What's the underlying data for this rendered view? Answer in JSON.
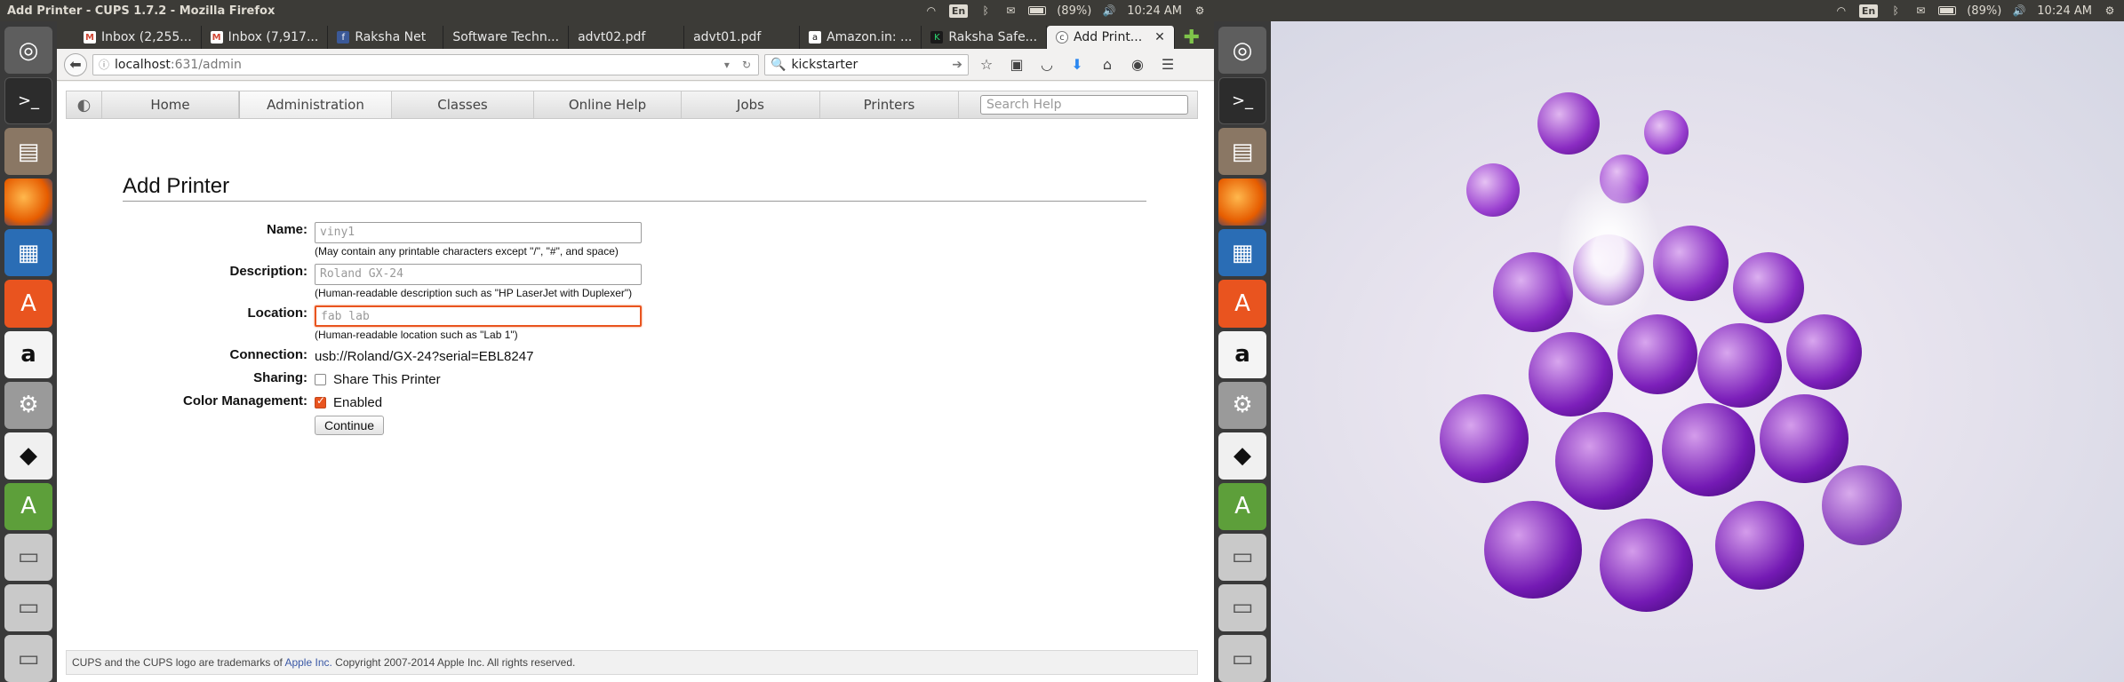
{
  "left": {
    "window_title": "Add Printer - CUPS 1.7.2 - Mozilla Firefox",
    "indicators": {
      "keyboard": "En",
      "battery": "(89%)",
      "time": "10:24 AM"
    },
    "launcher_icons": [
      "ubuntu-dash-icon",
      "terminal-icon",
      "files-icon",
      "firefox-icon",
      "writer-icon",
      "software-center-icon",
      "amazon-icon",
      "settings-icon",
      "inkscape-icon",
      "updater-icon",
      "drive-icon",
      "drive-icon",
      "drive-icon"
    ],
    "tabs": [
      {
        "label": "Inbox (2,255...",
        "icon": "gmail-icon"
      },
      {
        "label": "Inbox (7,917...",
        "icon": "gmail-icon"
      },
      {
        "label": "Raksha Net",
        "icon": "facebook-icon"
      },
      {
        "label": "Software Techn...",
        "icon": "none"
      },
      {
        "label": "advt02.pdf",
        "icon": "none"
      },
      {
        "label": "advt01.pdf",
        "icon": "none"
      },
      {
        "label": "Amazon.in: ...",
        "icon": "amazon-icon"
      },
      {
        "label": "Raksha Safe...",
        "icon": "kickstarter-icon"
      },
      {
        "label": "Add Print...",
        "icon": "cups-icon",
        "active": true
      }
    ],
    "url": {
      "host": "localhost",
      "path": ":631/admin"
    },
    "search_engine_text": "kickstarter",
    "cups_nav": {
      "tabs": [
        "Home",
        "Administration",
        "Classes",
        "Online Help",
        "Jobs",
        "Printers"
      ],
      "active": "Administration",
      "search_placeholder": "Search Help"
    },
    "form": {
      "title": "Add Printer",
      "name_label": "Name:",
      "name_value": "viny1",
      "name_hint": "(May contain any printable characters except \"/\", \"#\", and space)",
      "description_label": "Description:",
      "description_value": "Roland GX-24",
      "description_hint": "(Human-readable description such as \"HP LaserJet with Duplexer\")",
      "location_label": "Location:",
      "location_value": "fab lab",
      "location_hint": "(Human-readable location such as \"Lab 1\")",
      "connection_label": "Connection:",
      "connection_value": "usb://Roland/GX-24?serial=EBL8247",
      "sharing_label": "Sharing:",
      "sharing_option": "Share This Printer",
      "sharing_checked": false,
      "color_label": "Color Management:",
      "color_option": "Enabled",
      "color_checked": true,
      "continue_label": "Continue"
    },
    "footer": {
      "text_before": "CUPS and the CUPS logo are trademarks of ",
      "link": "Apple Inc.",
      "text_after": " Copyright 2007-2014 Apple Inc. All rights reserved."
    }
  },
  "right": {
    "indicators": {
      "keyboard": "En",
      "battery": "(89%)",
      "time": "10:24 AM"
    }
  },
  "colors": {
    "accent": "#e9541f",
    "panel": "#3c3b37",
    "launcher": "#3a3a3a"
  }
}
